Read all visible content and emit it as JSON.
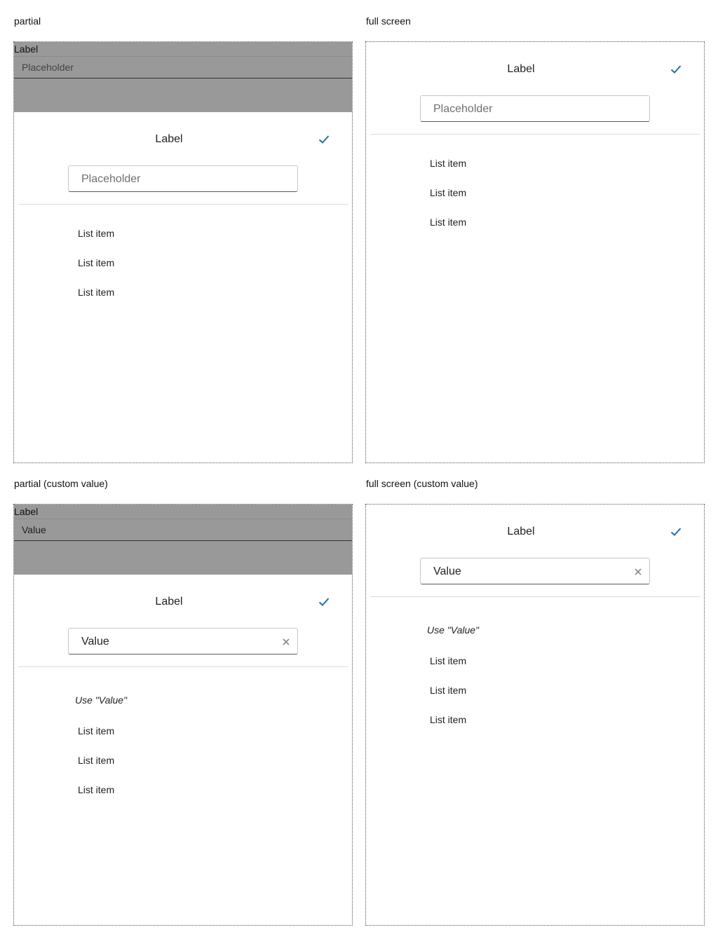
{
  "sections": {
    "partial": "partial",
    "full": "full screen",
    "partial_custom": "partial (custom value)",
    "full_custom": "full screen (custom value)"
  },
  "background_field": {
    "label": "Label",
    "placeholder": "Placeholder",
    "value": "Value"
  },
  "sheet": {
    "title": "Label",
    "placeholder": "Placeholder",
    "value": "Value",
    "custom_option": "Use \"Value\"",
    "items": [
      "List item",
      "List item",
      "List item"
    ]
  },
  "colors": {
    "accent": "#1a6fb4",
    "scrim": "#999999"
  },
  "icons": {
    "confirm": "check-icon",
    "clear": "close-icon"
  }
}
